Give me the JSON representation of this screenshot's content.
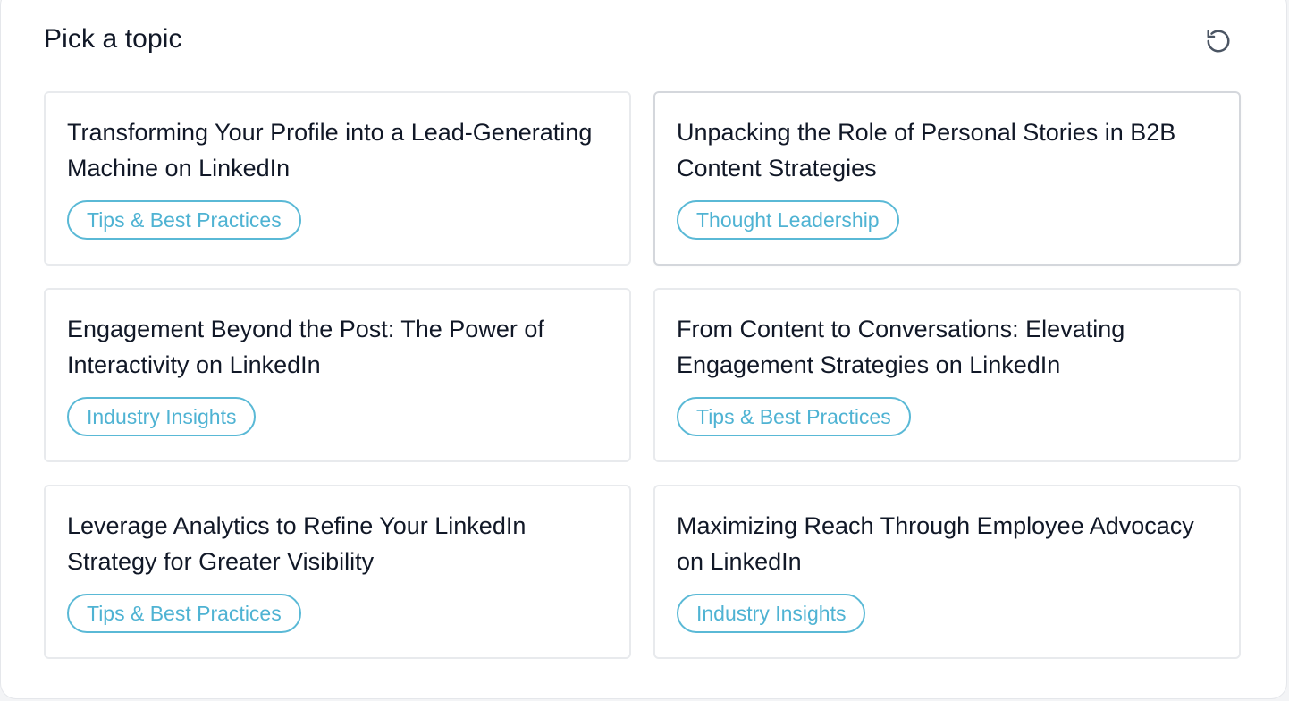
{
  "header": {
    "title": "Pick a topic",
    "refresh_icon": "refresh-icon"
  },
  "colors": {
    "accent": "#4fb3d3",
    "title_text": "#111827",
    "card_border": "#e8eaed"
  },
  "topics": [
    {
      "title": "Transforming Your Profile into a Lead-Generating Machine on LinkedIn",
      "tag": "Tips & Best Practices"
    },
    {
      "title": "Unpacking the Role of Personal Stories in B2B Content Strategies",
      "tag": "Thought Leadership"
    },
    {
      "title": "Engagement Beyond the Post: The Power of Interactivity on LinkedIn",
      "tag": "Industry Insights"
    },
    {
      "title": "From Content to Conversations: Elevating Engagement Strategies on LinkedIn",
      "tag": "Tips & Best Practices"
    },
    {
      "title": "Leverage Analytics to Refine Your LinkedIn Strategy for Greater Visibility",
      "tag": "Tips & Best Practices"
    },
    {
      "title": "Maximizing Reach Through Employee Advocacy on LinkedIn",
      "tag": "Industry Insights"
    }
  ]
}
